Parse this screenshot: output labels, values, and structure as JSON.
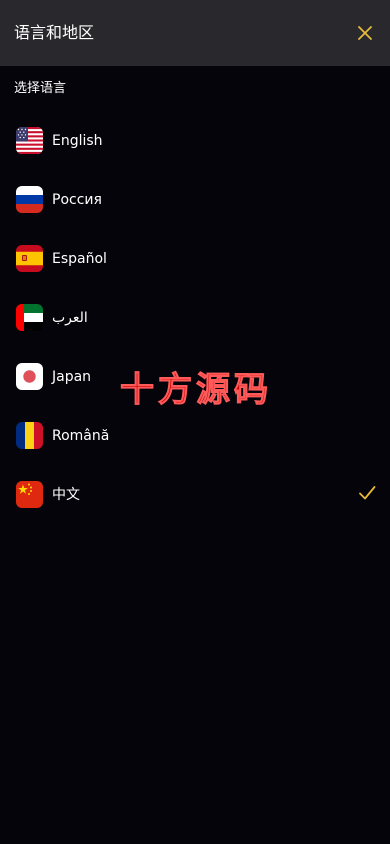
{
  "header": {
    "title": "语言和地区",
    "close_icon": "close-icon",
    "accent_color": "#e8b93a"
  },
  "section": {
    "label": "选择语言"
  },
  "languages": [
    {
      "label": "English",
      "flag": "us-flag-icon",
      "selected": false
    },
    {
      "label": "Россия",
      "flag": "russia-flag-icon",
      "selected": false
    },
    {
      "label": "Español",
      "flag": "spain-flag-icon",
      "selected": false
    },
    {
      "label": "العرب",
      "flag": "uae-flag-icon",
      "selected": false
    },
    {
      "label": "Japan",
      "flag": "japan-flag-icon",
      "selected": false
    },
    {
      "label": "Română",
      "flag": "romania-flag-icon",
      "selected": false
    },
    {
      "label": "中文",
      "flag": "china-flag-icon",
      "selected": true
    }
  ],
  "selected_indicator": "checkmark-icon",
  "watermark": "十方源码"
}
